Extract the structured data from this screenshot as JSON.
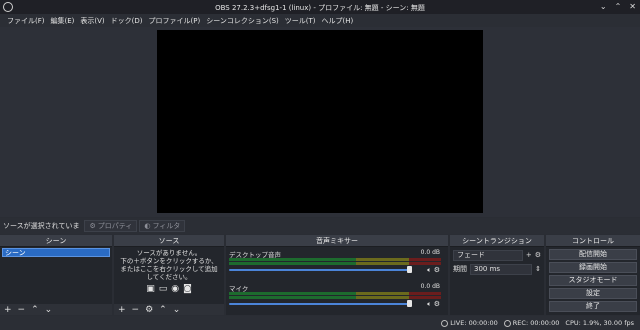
{
  "window": {
    "title": "OBS 27.2.3+dfsg1-1 (linux) - プロファイル: 無題 - シーン: 無題"
  },
  "menu": [
    "ファイル(F)",
    "編集(E)",
    "表示(V)",
    "ドック(D)",
    "プロファイル(P)",
    "シーンコレクション(S)",
    "ツール(T)",
    "ヘルプ(H)"
  ],
  "source_toolbar": {
    "no_selection": "ソースが選択されていま",
    "properties": "プロパティ",
    "filters": "フィルタ"
  },
  "scenes": {
    "header": "シーン",
    "items": [
      "シーン"
    ]
  },
  "sources": {
    "header": "ソース",
    "empty_line1": "ソースがありません。",
    "empty_line2": "下の＋ボタンをクリックするか、",
    "empty_line3": "またはここを右クリックして追加",
    "empty_line4": "してください。"
  },
  "mixer": {
    "header": "音声ミキサー",
    "channels": [
      {
        "name": "デスクトップ音声",
        "db": "0.0 dB"
      },
      {
        "name": "マイク",
        "db": "0.0 dB"
      }
    ]
  },
  "transitions": {
    "header": "シーントランジション",
    "selected": "フェード",
    "duration_label": "期間",
    "duration_value": "300 ms"
  },
  "controls": {
    "header": "コントロール",
    "buttons": [
      "配信開始",
      "録画開始",
      "スタジオモード",
      "設定",
      "終了"
    ]
  },
  "status": {
    "live": "LIVE: 00:00:00",
    "rec": "REC: 00:00:00",
    "cpu": "CPU: 1.9%, 30.00 fps"
  }
}
